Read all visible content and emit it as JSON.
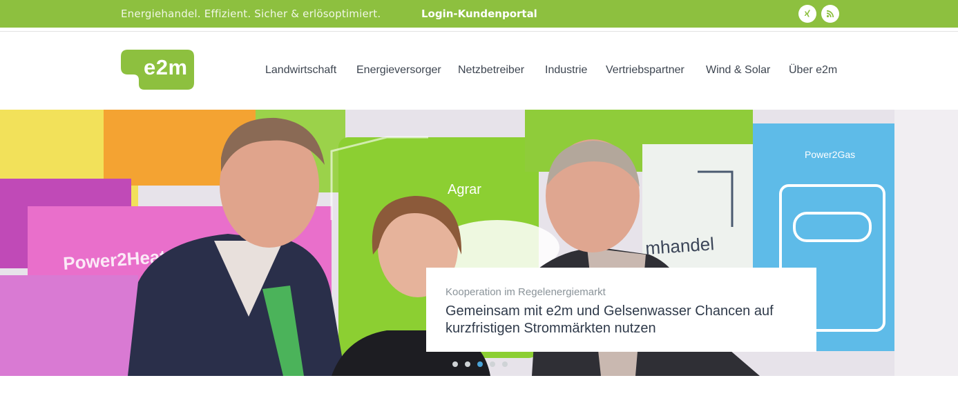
{
  "topbar": {
    "tagline": "Energiehandel. Effizient. Sicher & erlösoptimiert.",
    "login_label": "Login-Kundenportal",
    "social": [
      {
        "icon": "xing-icon"
      },
      {
        "icon": "rss-icon"
      }
    ],
    "accent_color": "#8dc03f"
  },
  "logo": {
    "text": "e2m"
  },
  "nav": {
    "items": [
      {
        "label": "Landwirtschaft"
      },
      {
        "label": "Energieversorger"
      },
      {
        "label": "Netzbetreiber"
      },
      {
        "label": "Industrie"
      },
      {
        "label": "Vertriebspartner"
      },
      {
        "label": "Wind & Solar"
      },
      {
        "label": "Über e2m"
      }
    ]
  },
  "hero": {
    "panel_texts": {
      "agrar": "Agrar",
      "power2heat": "Power2Heat",
      "power2gas": "Power2Gas",
      "handel": "mhandel"
    },
    "caption": {
      "kicker": "Kooperation im Regelenergiemarkt",
      "title": "Gemeinsam mit e2m und Gelsenwasser Chancen auf kurzfristigen Strommärkten nutzen"
    },
    "slider": {
      "count": 5,
      "active": 3
    }
  }
}
